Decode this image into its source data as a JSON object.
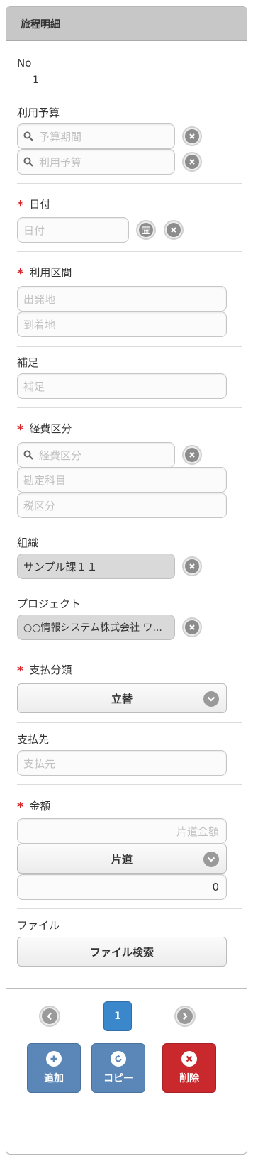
{
  "header": {
    "title": "旅程明細"
  },
  "no": {
    "label": "No",
    "value": "1"
  },
  "budget": {
    "label": "利用予算",
    "period_placeholder": "予算期間",
    "budget_placeholder": "利用予算"
  },
  "date": {
    "label": "日付",
    "placeholder": "日付"
  },
  "route": {
    "label": "利用区間",
    "from_placeholder": "出発地",
    "to_placeholder": "到着地"
  },
  "supplement": {
    "label": "補足",
    "placeholder": "補足"
  },
  "expense": {
    "label": "経費区分",
    "category_placeholder": "経費区分",
    "account_placeholder": "勘定科目",
    "tax_placeholder": "税区分"
  },
  "organization": {
    "label": "組織",
    "value": "サンプル課１１"
  },
  "project": {
    "label": "プロジェクト",
    "value": "○○情報システム株式会社 ワ..."
  },
  "payment_type": {
    "label": "支払分類",
    "selected": "立替"
  },
  "payee": {
    "label": "支払先",
    "placeholder": "支払先"
  },
  "amount": {
    "label": "金額",
    "oneway_placeholder": "片道金額",
    "trip_selected": "片道",
    "total_value": "0"
  },
  "file": {
    "label": "ファイル",
    "button": "ファイル検索"
  },
  "pager": {
    "current": "1"
  },
  "actions": {
    "add": "追加",
    "copy": "コピー",
    "delete": "削除"
  },
  "colors": {
    "required": "#d9262d",
    "primary": "#5b87b8",
    "danger": "#c9282d",
    "page": "#3a87cc"
  }
}
